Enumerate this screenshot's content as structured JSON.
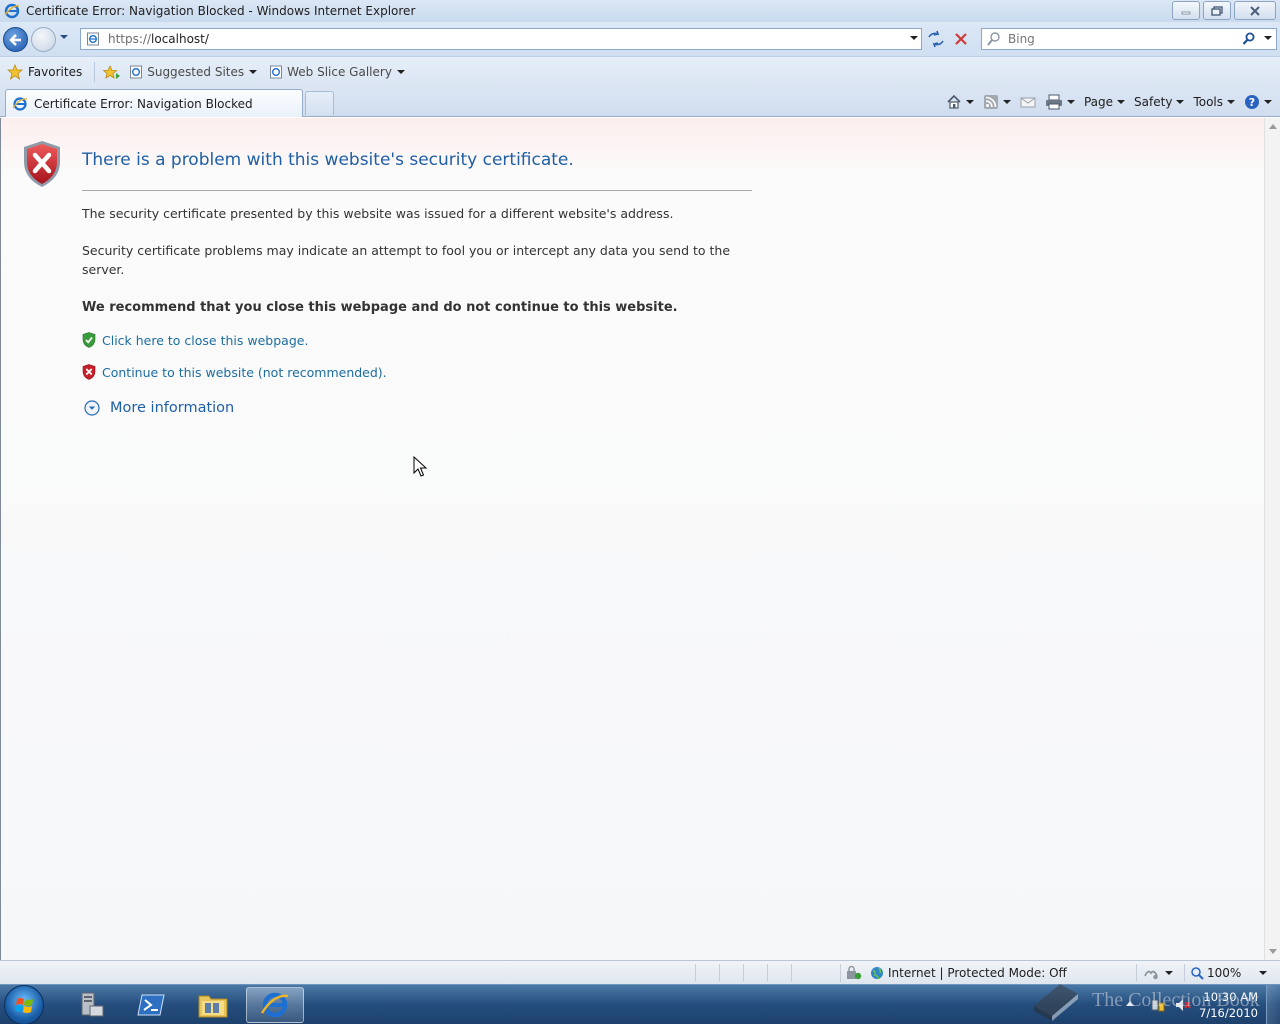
{
  "window": {
    "title": "Certificate Error: Navigation Blocked - Windows Internet Explorer"
  },
  "nav": {
    "url_prefix": "https://",
    "url_host": "localhost/",
    "search_placeholder": "Bing"
  },
  "favorites_bar": {
    "favorites_label": "Favorites",
    "items": [
      {
        "label": "Suggested Sites"
      },
      {
        "label": "Web Slice Gallery"
      }
    ]
  },
  "tabs": {
    "active_label": "Certificate Error: Navigation Blocked"
  },
  "command_bar": {
    "page_label": "Page",
    "safety_label": "Safety",
    "tools_label": "Tools"
  },
  "content": {
    "heading": "There is a problem with this website's security certificate.",
    "p1": "The security certificate presented by this website was issued for a different website's address.",
    "p2": "Security certificate problems may indicate an attempt to fool you or intercept any data you send to the server.",
    "recommend": "We recommend that you close this webpage and do not continue to this website.",
    "close_link": "Click here to close this webpage.",
    "continue_link": "Continue to this website (not recommended).",
    "more_info": "More information"
  },
  "status_bar": {
    "zone": "Internet | Protected Mode: Off",
    "zoom": "100%"
  },
  "taskbar": {
    "time": "10:30 AM",
    "date": "7/16/2010"
  },
  "watermark": {
    "text": "The Collection Book"
  },
  "colors": {
    "link": "#1c6da0",
    "heading": "#1f5fa6",
    "error_red": "#c8202b",
    "safe_green": "#3a9b3a"
  }
}
